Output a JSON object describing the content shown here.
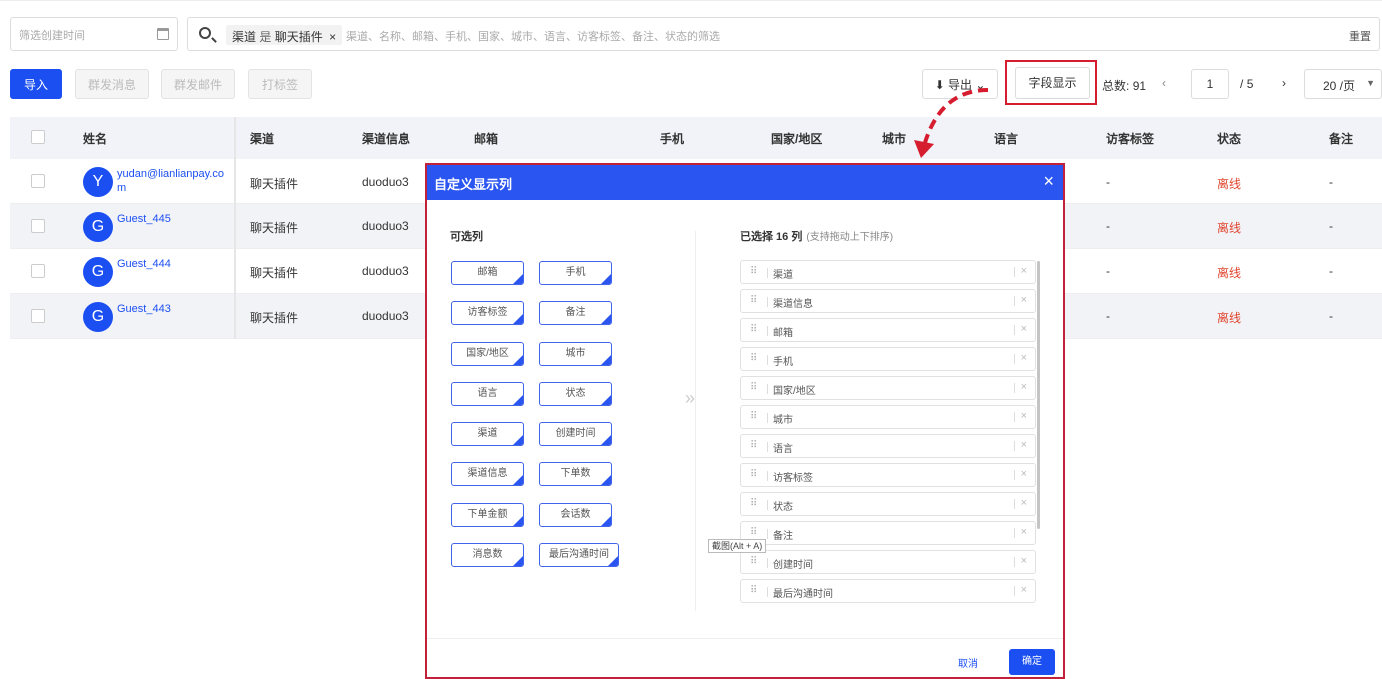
{
  "filters": {
    "date_placeholder": "筛选创建时间",
    "tag_field": "渠道",
    "tag_op": "是",
    "tag_value": "聊天插件",
    "tag_remove": "×",
    "search_placeholder": "渠道、名称、邮箱、手机、国家、城市、语言、访客标签、备注、状态的筛选",
    "reset_icon": "重置"
  },
  "toolbar": {
    "import_label": "导入",
    "bulk_message_label": "群发消息",
    "bulk_email_label": "群发邮件",
    "tag_label": "打标签",
    "export_label": "导出",
    "field_display_label": "字段显示"
  },
  "pagination": {
    "total_label": "总数:",
    "total": "91",
    "prev_icon": "‹",
    "next_icon": "›",
    "current_page": "1",
    "page_sep": "/",
    "total_pages": "5",
    "page_size": "20 /页"
  },
  "table": {
    "headers": [
      "姓名",
      "渠道",
      "渠道信息",
      "邮箱",
      "手机",
      "国家/地区",
      "城市",
      "语言",
      "访客标签",
      "状态",
      "备注"
    ],
    "rows": [
      {
        "initial": "Y",
        "name": "yudan@lianlianpay.com",
        "channel": "聊天插件",
        "channel_info": "duoduo3",
        "tags": "-",
        "status": "离线",
        "note": "-"
      },
      {
        "initial": "G",
        "name": "Guest_445",
        "channel": "聊天插件",
        "channel_info": "duoduo3",
        "tags": "-",
        "status": "离线",
        "note": "-"
      },
      {
        "initial": "G",
        "name": "Guest_444",
        "channel": "聊天插件",
        "channel_info": "duoduo3",
        "tags": "-",
        "status": "离线",
        "note": "-"
      },
      {
        "initial": "G",
        "name": "Guest_443",
        "channel": "聊天插件",
        "channel_info": "duoduo3",
        "tags": "-",
        "status": "离线",
        "note": "-"
      }
    ]
  },
  "modal": {
    "title": "自定义显示列",
    "close_icon": "×",
    "available_title": "可选列",
    "available": [
      "邮箱",
      "手机",
      "访客标签",
      "备注",
      "国家/地区",
      "城市",
      "语言",
      "状态",
      "渠道",
      "创建时间",
      "渠道信息",
      "下单数",
      "下单金额",
      "会话数",
      "消息数",
      "最后沟通时间"
    ],
    "selected_title": "已选择 16 列",
    "selected_hint": "(支持拖动上下排序)",
    "selected": [
      "渠道",
      "渠道信息",
      "邮箱",
      "手机",
      "国家/地区",
      "城市",
      "语言",
      "访客标签",
      "状态",
      "备注",
      "创建时间",
      "最后沟通时间"
    ],
    "drag_handle": "⠿",
    "remove_icon": "×",
    "transfer_icon": "»",
    "tooltip": "截图(Alt + A)",
    "cancel_label": "取消",
    "ok_label": "确定"
  },
  "colors": {
    "primary": "#1b4ff2",
    "modal_header": "#2b55f0",
    "highlight": "#d61c2f",
    "offline": "#e0462f"
  }
}
